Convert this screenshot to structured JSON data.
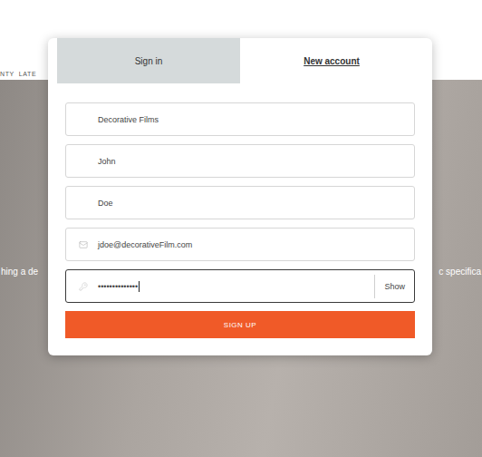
{
  "header": {
    "nav": [
      "NTY",
      "LATE"
    ]
  },
  "hero": {
    "text_left": "hing a de",
    "text_right": "c specifica"
  },
  "tabs": [
    {
      "label": "Sign in",
      "selected": false
    },
    {
      "label": "New account",
      "selected": true
    }
  ],
  "fields": [
    {
      "kind": "text",
      "value": "Decorative Films",
      "focused": false
    },
    {
      "kind": "text",
      "value": "John",
      "focused": false
    },
    {
      "kind": "text",
      "value": "Doe",
      "focused": false
    },
    {
      "kind": "email",
      "value": "jdoe@decorativeFilm.com",
      "focused": false
    },
    {
      "kind": "password",
      "value": "••••••••••••••",
      "focused": true,
      "toggle": "Show"
    }
  ],
  "submit": "SIGN UP"
}
